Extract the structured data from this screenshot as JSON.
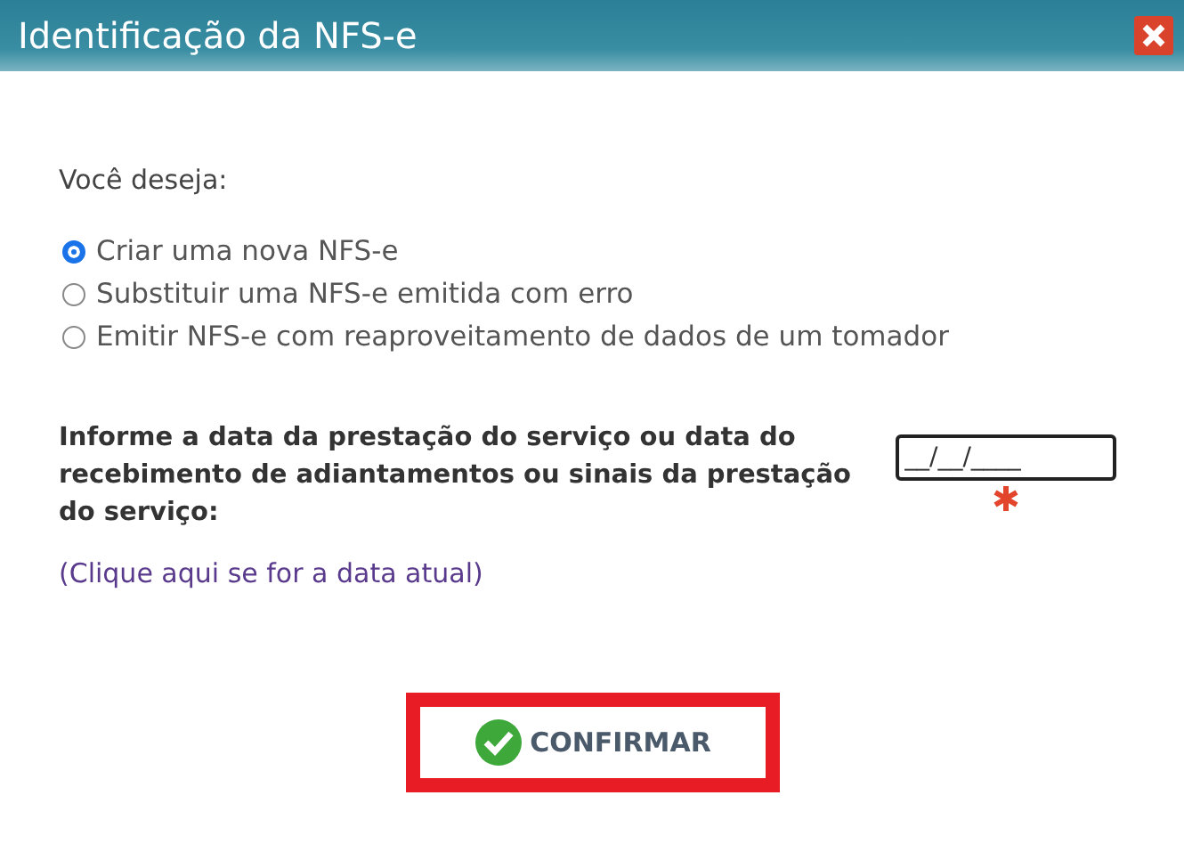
{
  "window": {
    "title": "Identificação da NFS-e"
  },
  "question": "Você deseja:",
  "options": [
    {
      "label": "Criar uma nova NFS-e",
      "selected": true
    },
    {
      "label": "Substituir uma NFS-e emitida com erro",
      "selected": false
    },
    {
      "label": "Emitir NFS-e com reaproveitamento de dados de um tomador",
      "selected": false
    }
  ],
  "date_prompt": "Informe a data da prestação do serviço ou data do recebimento de adiantamentos ou sinais da prestação do serviço:",
  "date_field": {
    "value": "__/__/____",
    "required": true
  },
  "today_link": "(Clique aqui se for a data atual)",
  "confirm_button": {
    "label": "CONFIRMAR",
    "highlighted": true
  }
}
